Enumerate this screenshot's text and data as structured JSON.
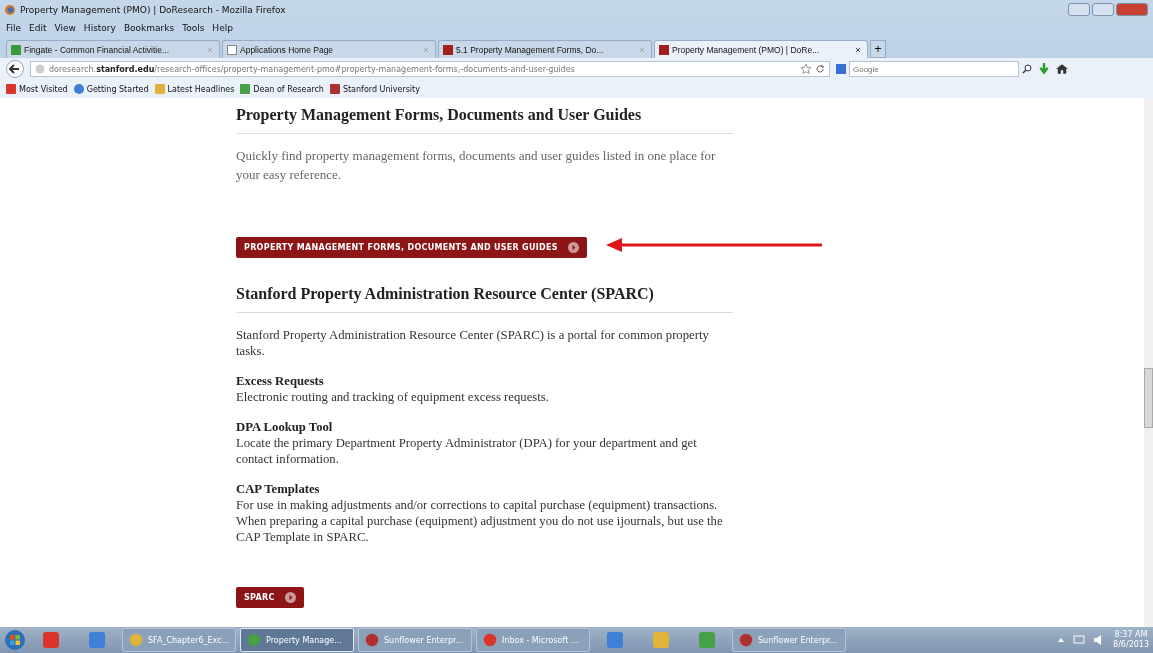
{
  "window": {
    "title": "Property Management (PMO) | DoResearch - Mozilla Firefox"
  },
  "menu": [
    "File",
    "Edit",
    "View",
    "History",
    "Bookmarks",
    "Tools",
    "Help"
  ],
  "tabs": [
    {
      "label": "Fingate - Common Financial Activitie...",
      "selected": false
    },
    {
      "label": "Applications Home Page",
      "selected": false
    },
    {
      "label": "5.1 Property Management Forms, Do...",
      "selected": false
    },
    {
      "label": "Property Management (PMO) | DoRe...",
      "selected": true
    }
  ],
  "new_tab": "+",
  "address": {
    "url": "doresearch.**stanford.edu**/research-offices/property-management-pmo#property-management-forms,-documents-and-user-guides"
  },
  "search": {
    "placeholder": "Google"
  },
  "bookmarks": [
    "Most Visited",
    "Getting Started",
    "Latest Headlines",
    "Dean of Research",
    "Stanford University"
  ],
  "content": {
    "forms_section": {
      "heading": "Property Management Forms, Documents and User Guides",
      "text": "Quickly find property management forms, documents and user guides listed in one place for your easy reference.",
      "button": "PROPERTY MANAGEMENT FORMS, DOCUMENTS AND USER GUIDES"
    },
    "sparc_section": {
      "heading": "Stanford Property Administration Resource Center (SPARC)",
      "text": "Stanford Property Administration Resource Center (SPARC) is a portal for common property tasks.",
      "items": [
        {
          "title": "Excess Requests",
          "text": "Electronic routing and tracking of equipment excess requests."
        },
        {
          "title": "DPA Lookup Tool",
          "text": "Locate the primary Department Property Administrator (DPA) for your department and get contact information."
        },
        {
          "title": "CAP Templates",
          "text": "For use in making adjustments and/or corrections to capital purchase (equipment) transactions. When preparing a capital purchase (equipment) adjustment you do not use ijournals, but use the CAP Template in SPARC."
        }
      ],
      "button": "SPARC"
    }
  },
  "taskbar": {
    "items": [
      {
        "kind": "pinned"
      },
      {
        "kind": "pinned"
      },
      {
        "kind": "app",
        "label": "SFA_Chapter6_Exc...",
        "selected": false
      },
      {
        "kind": "app",
        "label": "Property Manage...",
        "selected": true
      },
      {
        "kind": "app",
        "label": "Sunflower Enterpr...",
        "selected": false
      },
      {
        "kind": "app",
        "label": "Inbox - Microsoft ...",
        "selected": false
      },
      {
        "kind": "pinned"
      },
      {
        "kind": "pinned"
      },
      {
        "kind": "pinned"
      },
      {
        "kind": "app",
        "label": "Sunflower Enterpr...",
        "selected": false
      }
    ],
    "time": "8:37 AM",
    "date": "8/6/2013"
  }
}
